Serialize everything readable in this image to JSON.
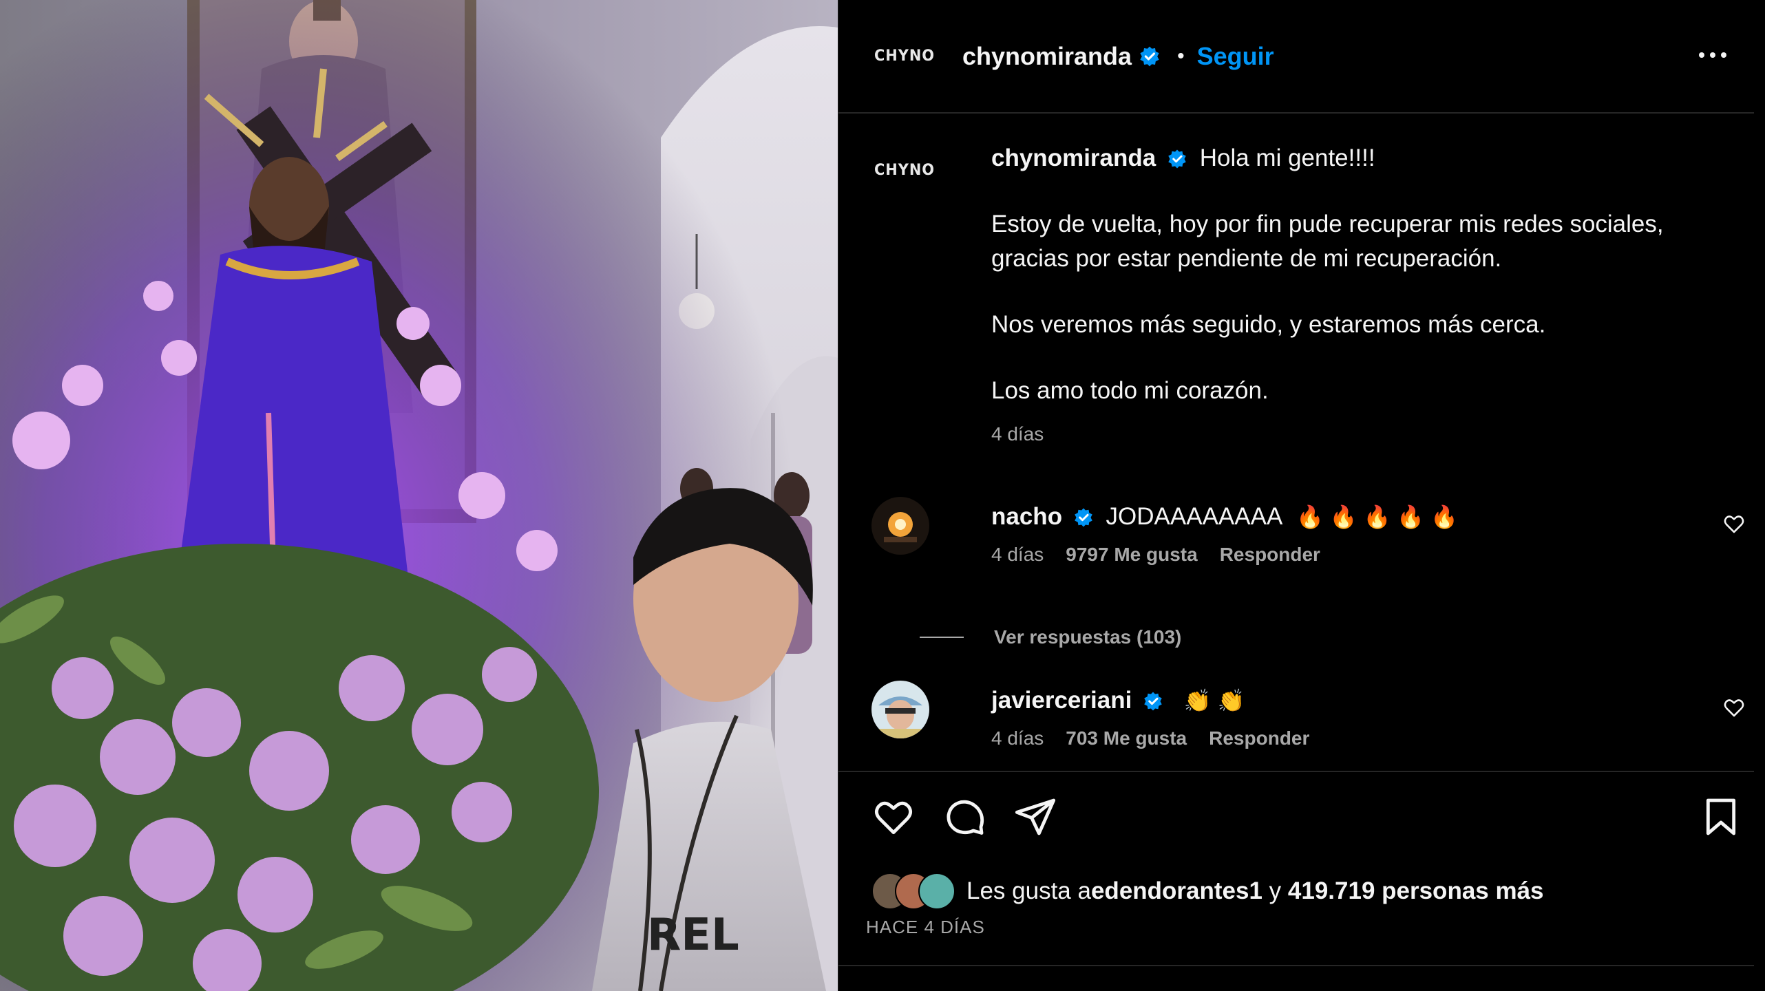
{
  "post": {
    "author": "chynomiranda",
    "follow_label": "Seguir",
    "logo_text": "CHYNO"
  },
  "caption": {
    "author": "chynomiranda",
    "first_line": "Hola mi gente!!!!",
    "paragraph1": "Estoy de vuelta, hoy por fin pude recuperar mis redes sociales,\ngracias por estar pendiente de mi recuperación.",
    "paragraph2": "Nos veremos más seguido, y estaremos más cerca.",
    "paragraph3": "Los amo todo mi corazón.",
    "time": "4 días"
  },
  "comments": [
    {
      "author": "nacho",
      "text": "JODAAAAAAAA",
      "emoji": "🔥 🔥 🔥 🔥 🔥",
      "time": "4 días",
      "likes": "9797 Me gusta",
      "reply_label": "Responder",
      "view_replies": "Ver respuestas (103)"
    },
    {
      "author": "javierceriani",
      "text": "",
      "emoji": "👏 👏",
      "time": "4 días",
      "likes": "703 Me gusta",
      "reply_label": "Responder"
    }
  ],
  "footer": {
    "likes_prefix": "Les gusta a ",
    "likes_user": "edendorantes1",
    "likes_middle": " y ",
    "likes_count": "419.719 personas más",
    "date": "HACE 4 DÍAS"
  },
  "icons": {
    "verified": "verified-badge-icon",
    "more": "more-options-icon",
    "like": "heart-icon",
    "comment": "comment-icon",
    "share": "send-icon",
    "save": "bookmark-icon"
  },
  "colors": {
    "background": "#000000",
    "text": "#f5f5f5",
    "muted": "#a8a8a8",
    "link": "#0095f6",
    "divider": "#262626"
  }
}
